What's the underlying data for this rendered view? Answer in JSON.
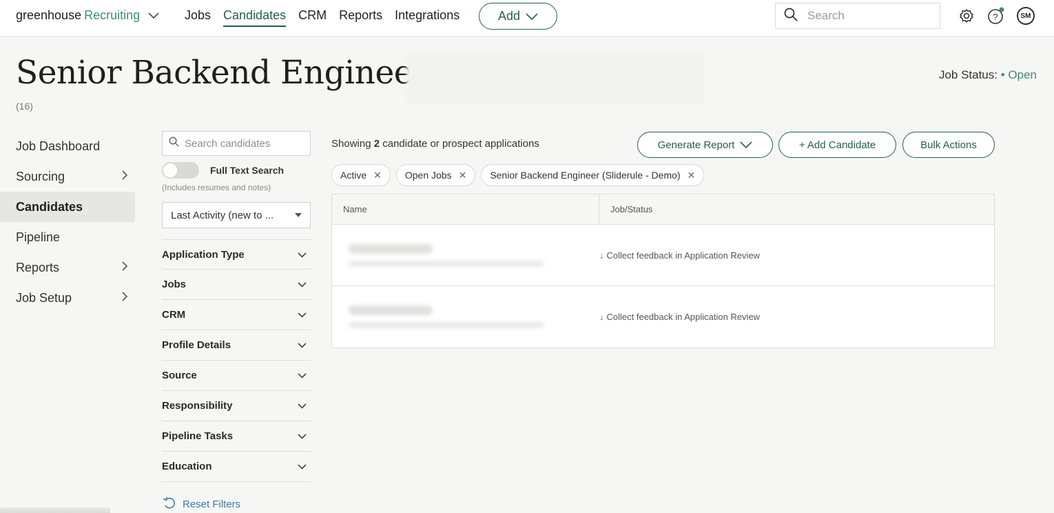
{
  "topnav": {
    "brand": "greenhouse",
    "product": "Recruiting",
    "links": [
      "Jobs",
      "Candidates",
      "CRM",
      "Reports",
      "Integrations"
    ],
    "active_link": "Candidates",
    "add_label": "Add",
    "search_placeholder": "Search",
    "avatar_initials": "SM",
    "icons": [
      "settings-gear-icon",
      "help-question-icon",
      "avatar"
    ]
  },
  "header": {
    "title": "Senior Backend Engineer",
    "count": "(16)",
    "job_status_label": "Job Status:",
    "job_status_value": "• Open"
  },
  "sidebar": {
    "items": [
      {
        "label": "Job Dashboard",
        "has_chevron": false,
        "active": false
      },
      {
        "label": "Sourcing",
        "has_chevron": true,
        "active": false
      },
      {
        "label": "Candidates",
        "has_chevron": false,
        "active": true
      },
      {
        "label": "Pipeline",
        "has_chevron": false,
        "active": false
      },
      {
        "label": "Reports",
        "has_chevron": true,
        "active": false
      },
      {
        "label": "Job Setup",
        "has_chevron": true,
        "active": false
      }
    ]
  },
  "filters": {
    "search_placeholder": "Search candidates",
    "full_text_label": "Full Text Search",
    "full_text_note": "(Includes resumes and notes)",
    "sort_value": "Last Activity (new to ...",
    "facets": [
      "Application Type",
      "Jobs",
      "CRM",
      "Profile Details",
      "Source",
      "Responsibility",
      "Pipeline Tasks",
      "Education"
    ],
    "reset_label": "Reset Filters"
  },
  "main": {
    "showing_prefix": "Showing",
    "showing_count": "2",
    "showing_suffix": "candidate or prospect applications",
    "buttons": {
      "generate_report": "Generate Report",
      "add_candidate": "+ Add Candidate",
      "bulk_actions": "Bulk Actions"
    },
    "chips": [
      "Active",
      "Open Jobs",
      "Senior Backend Engineer (Sliderule - Demo)"
    ],
    "table": {
      "headers": [
        "Name",
        "Job/Status"
      ],
      "rows": [
        {
          "status": "Collect feedback in Application Review"
        },
        {
          "status": "Collect feedback in Application Review"
        }
      ]
    }
  },
  "colors": {
    "accent": "#24604a",
    "brand_green": "#3f8f6e",
    "link_blue": "#3b7fa6"
  }
}
